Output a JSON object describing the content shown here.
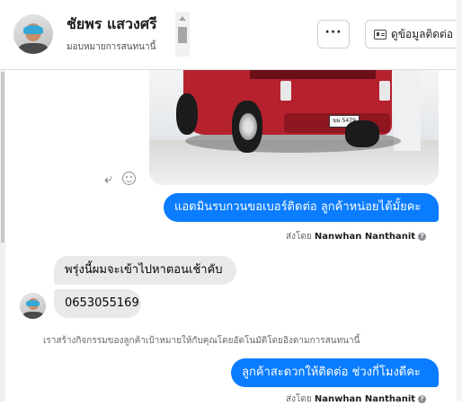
{
  "header": {
    "contact_name": "ชัยพร แสวงศรี",
    "assign_label": "มอบหมายการสนทนานี้",
    "more_label": "···",
    "view_contact_label": "ดูข้อมูลติดต่อ"
  },
  "conversation": {
    "image_plate_text": "ฆษ 5479",
    "messages": [
      {
        "direction": "outgoing",
        "text": "แอดมินรบกวนขอเบอร์ติดต่อ ลูกค้าหน่อยได้มั้ยคะ"
      },
      {
        "direction": "incoming",
        "text": "พรุ่งนี้ผมจะเข้าไปหาตอนเช้าคับ"
      },
      {
        "direction": "incoming",
        "text": "0653055169"
      },
      {
        "direction": "outgoing",
        "text": "ลูกค้าสะดวกให้ติดต่อ ช่วงกี่โมงดีคะ"
      }
    ],
    "sent_by_prefix": "ส่งโดย",
    "sent_by_name": "Nanwhan Nanthanit",
    "info_glyph": "?",
    "system_notice": "เราสร้างกิจกรรมของลูกค้าเป้าหมายให้กับคุณโดยอัตโนมัติโดยอิงตามการสนทนานี้"
  },
  "icons": {
    "reply": "reply-icon",
    "reaction": "smiley-icon",
    "contact_card": "contact-card-icon",
    "caret": "chevron-down-icon"
  },
  "colors": {
    "outgoing_bubble": "#0a7cff",
    "incoming_bubble": "#e9e9eb",
    "meta_text": "#65676b"
  }
}
